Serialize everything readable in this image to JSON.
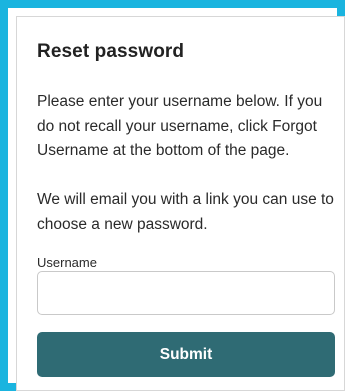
{
  "form": {
    "title": "Reset password",
    "paragraph1": "Please enter your username below. If you do not recall your username, click Forgot Username at the bottom of the page.",
    "paragraph2": "We will email you with a link you can use to choose a new password.",
    "username_label": "Username",
    "username_value": "",
    "username_placeholder": "",
    "submit_label": "Submit"
  },
  "colors": {
    "frame_border": "#1ab4df",
    "button_background": "#2f6b74",
    "button_text": "#ffffff"
  }
}
